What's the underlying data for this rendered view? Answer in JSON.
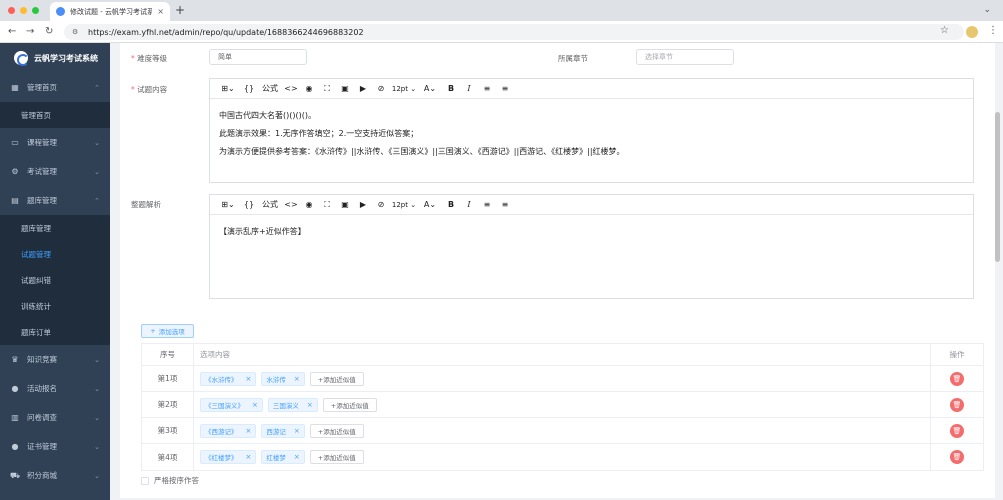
{
  "browser": {
    "tab_title": "修改试题 - 云帆学习考试系统",
    "url": "https://exam.yfhl.net/admin/repo/qu/update/1688366244696883202"
  },
  "sidebar": {
    "brand": "云帆学习考试系统",
    "items": [
      {
        "label": "管理首页",
        "icon": "dashboard-icon",
        "expanded": true,
        "children": [
          {
            "label": "管理首页"
          }
        ]
      },
      {
        "label": "课程管理",
        "icon": "monitor-icon"
      },
      {
        "label": "考试管理",
        "icon": "settings-icon"
      },
      {
        "label": "题库管理",
        "icon": "document-icon",
        "expanded": true,
        "children": [
          {
            "label": "题库管理"
          },
          {
            "label": "试题管理",
            "active": true
          },
          {
            "label": "试题纠错"
          },
          {
            "label": "训练统计"
          },
          {
            "label": "题库订单"
          }
        ]
      },
      {
        "label": "知识竞赛",
        "icon": "trophy-icon"
      },
      {
        "label": "活动报名",
        "icon": "info-icon"
      },
      {
        "label": "问卷调查",
        "icon": "survey-icon"
      },
      {
        "label": "证书管理",
        "icon": "certificate-icon"
      },
      {
        "label": "积分商城",
        "icon": "cart-icon"
      }
    ]
  },
  "form": {
    "difficulty_label": "难度等级",
    "difficulty_value": "简单",
    "chapter_label": "所属章节",
    "chapter_placeholder": "选择章节",
    "content_label": "试题内容",
    "analysis_label": "整题解析",
    "toolbar": {
      "formula": "公式",
      "font_size": "12pt"
    },
    "content_lines": [
      "中国古代四大名著()()()()。",
      "此题演示效果：1.无序作答填空；2.一空支持近似答案；",
      "为演示方便提供参考答案：《水浒传》||水浒传、《三国演义》||三国演义、《西游记》||西游记、《红楼梦》||红楼梦。"
    ],
    "analysis_text": "【演示乱序+近似作答】",
    "add_option_label": "添加选项",
    "strict_order_label": "严格按序作答"
  },
  "table": {
    "headers": {
      "no": "序号",
      "content": "选项内容",
      "op": "操作"
    },
    "add_similar_label": "+添加近似值",
    "rows": [
      {
        "no": "第1项",
        "tags": [
          "《水浒传》",
          "水浒传"
        ]
      },
      {
        "no": "第2项",
        "tags": [
          "《三国演义》",
          "三国演义"
        ]
      },
      {
        "no": "第3项",
        "tags": [
          "《西游记》",
          "西游记"
        ]
      },
      {
        "no": "第4项",
        "tags": [
          "《红楼梦》",
          "红楼梦"
        ]
      }
    ]
  },
  "colors": {
    "sidebar_bg": "#304156",
    "accent": "#409eff",
    "danger": "#f56c6c"
  }
}
